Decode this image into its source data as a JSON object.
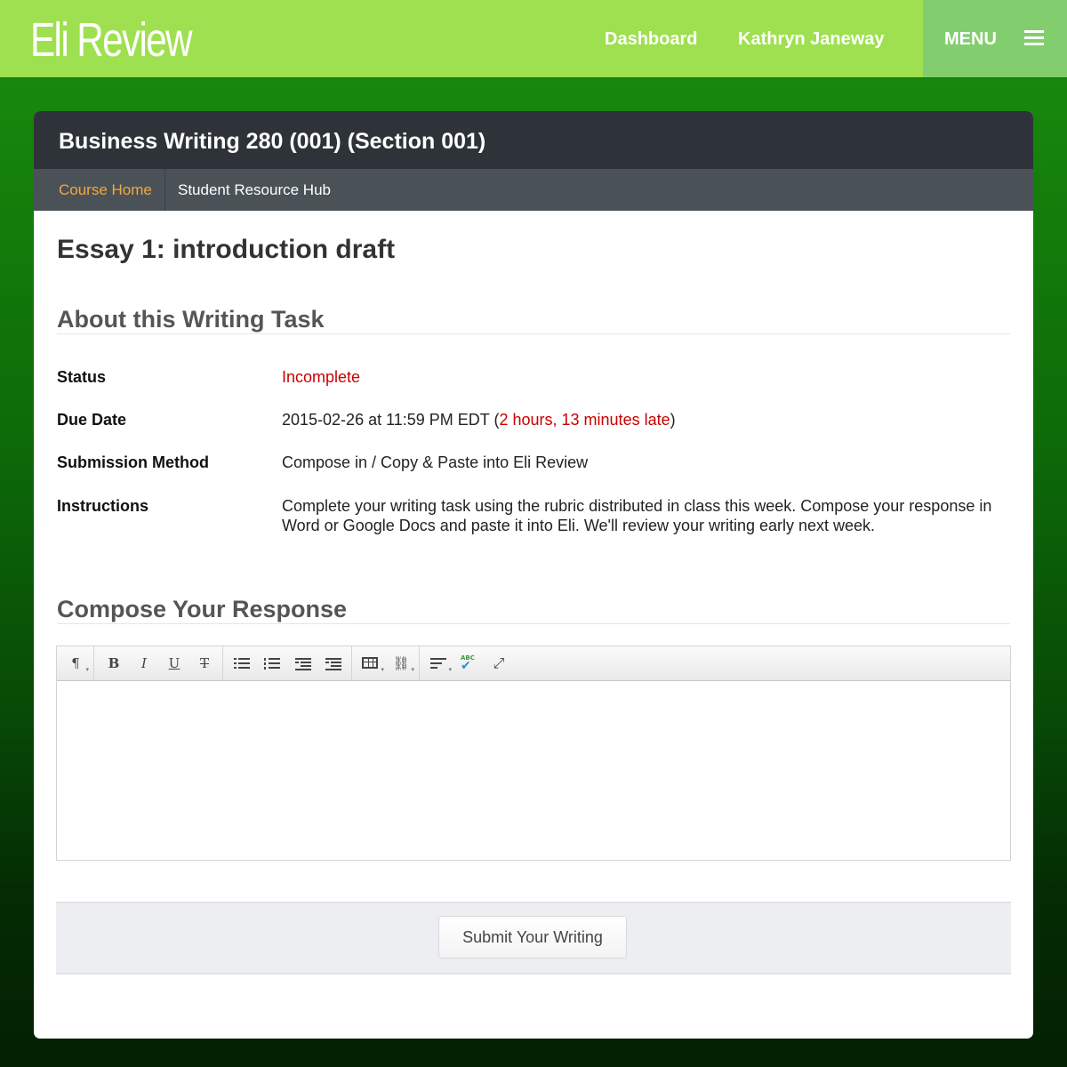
{
  "topbar": {
    "logo": "Eli Review",
    "nav_dashboard": "Dashboard",
    "nav_user": "Kathryn Janeway",
    "menu_label": "MENU"
  },
  "course": {
    "title": "Business Writing 280 (001) (Section 001)",
    "subnav": {
      "home": "Course Home",
      "hub": "Student Resource Hub"
    }
  },
  "page": {
    "title": "Essay 1: introduction draft"
  },
  "about": {
    "heading": "About this Writing Task",
    "status_label": "Status",
    "status_value": "Incomplete",
    "due_label": "Due Date",
    "due_value": "2015-02-26 at 11:59 PM EDT",
    "due_late": "2 hours, 13 minutes late",
    "method_label": "Submission Method",
    "method_value": "Compose in / Copy & Paste into Eli Review",
    "instructions_label": "Instructions",
    "instructions_value": "Complete your writing task using the rubric distributed in class this week. Compose your response in Word or Google Docs and paste it into Eli. We'll review your writing early next week."
  },
  "compose": {
    "heading": "Compose Your Response",
    "toolbar": {
      "paragraph_glyph": "¶",
      "bold_glyph": "B",
      "italic_glyph": "I",
      "underline_glyph": "U",
      "strike_glyph": "T",
      "spellcheck_glyph": "ABC",
      "expand_glyph": "⤢",
      "link_glyph": "⛓"
    },
    "editor_value": ""
  },
  "submit": {
    "label": "Submit Your Writing"
  },
  "colors": {
    "topbar": "#9ee04f",
    "menu": "#82ce6e",
    "header": "#2d3339",
    "subnav": "#4a5257",
    "accent_orange": "#f4a742",
    "late_red": "#c80000"
  }
}
